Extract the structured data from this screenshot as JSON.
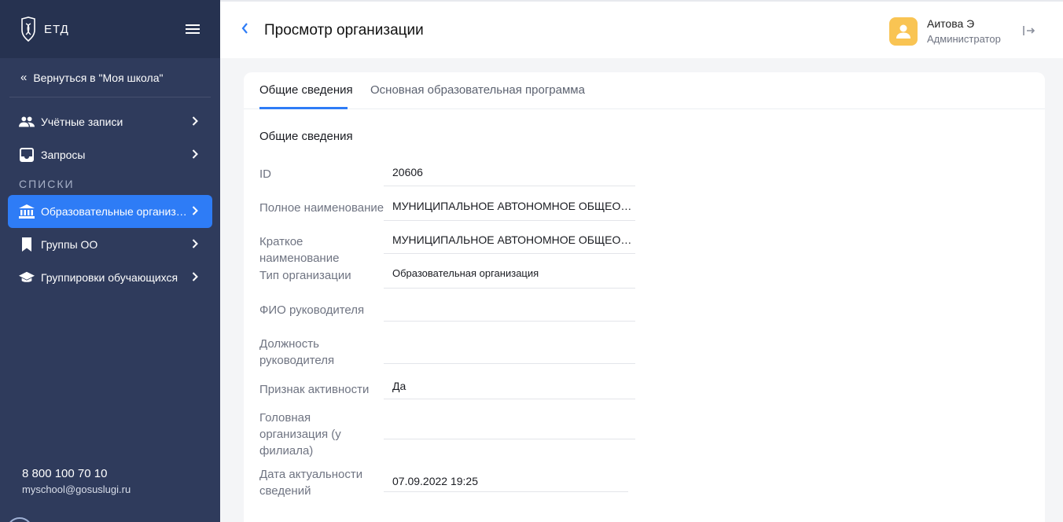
{
  "sidebar": {
    "logo_text": "ЕТД",
    "back_label": "Вернуться в \"Моя школа\"",
    "items": [
      {
        "label": "Учётные записи"
      },
      {
        "label": "Запросы"
      }
    ],
    "section_label": "СПИСКИ",
    "list_items": [
      {
        "label": "Образовательные организации"
      },
      {
        "label": "Группы ОО"
      },
      {
        "label": "Группировки обучающихся"
      }
    ],
    "phone": "8 800 100 70 10",
    "email": "myschool@gosuslugi.ru"
  },
  "header": {
    "title": "Просмотр организации",
    "user_name": "Аитова Э",
    "user_role": "Администратор"
  },
  "tabs": [
    {
      "label": "Общие сведения"
    },
    {
      "label": "Основная образовательная программа"
    }
  ],
  "section_title": "Общие сведения",
  "fields": [
    {
      "label": "ID",
      "value": "20606"
    },
    {
      "label": "Полное наименование",
      "value": "МУНИЦИПАЛЬНОЕ АВТОНОМНОЕ ОБЩЕОБРАЗОВАТЕЛЬНОЕ УЧРЕЖДЕНИЕ"
    },
    {
      "label": "Краткое наименование",
      "value": "МУНИЦИПАЛЬНОЕ АВТОНОМНОЕ ОБЩЕОБРАЗОВАТЕЛЬНОЕ УЧРЕЖДЕНИЕ"
    },
    {
      "label": "Тип организации",
      "value": "Образовательная организация"
    },
    {
      "label": "ФИО руководителя",
      "value": ""
    },
    {
      "label": "Должность руководителя",
      "value": ""
    },
    {
      "label": "Признак активности",
      "value": "Да"
    },
    {
      "label": "Головная организация (у филиала)",
      "value": ""
    },
    {
      "label": "Дата актуальности сведений",
      "value": "07.09.2022 19:25"
    }
  ],
  "colors": {
    "sidebar": "#2f3b5c",
    "accent": "#2e7cf6",
    "avatar": "#f9c453"
  }
}
